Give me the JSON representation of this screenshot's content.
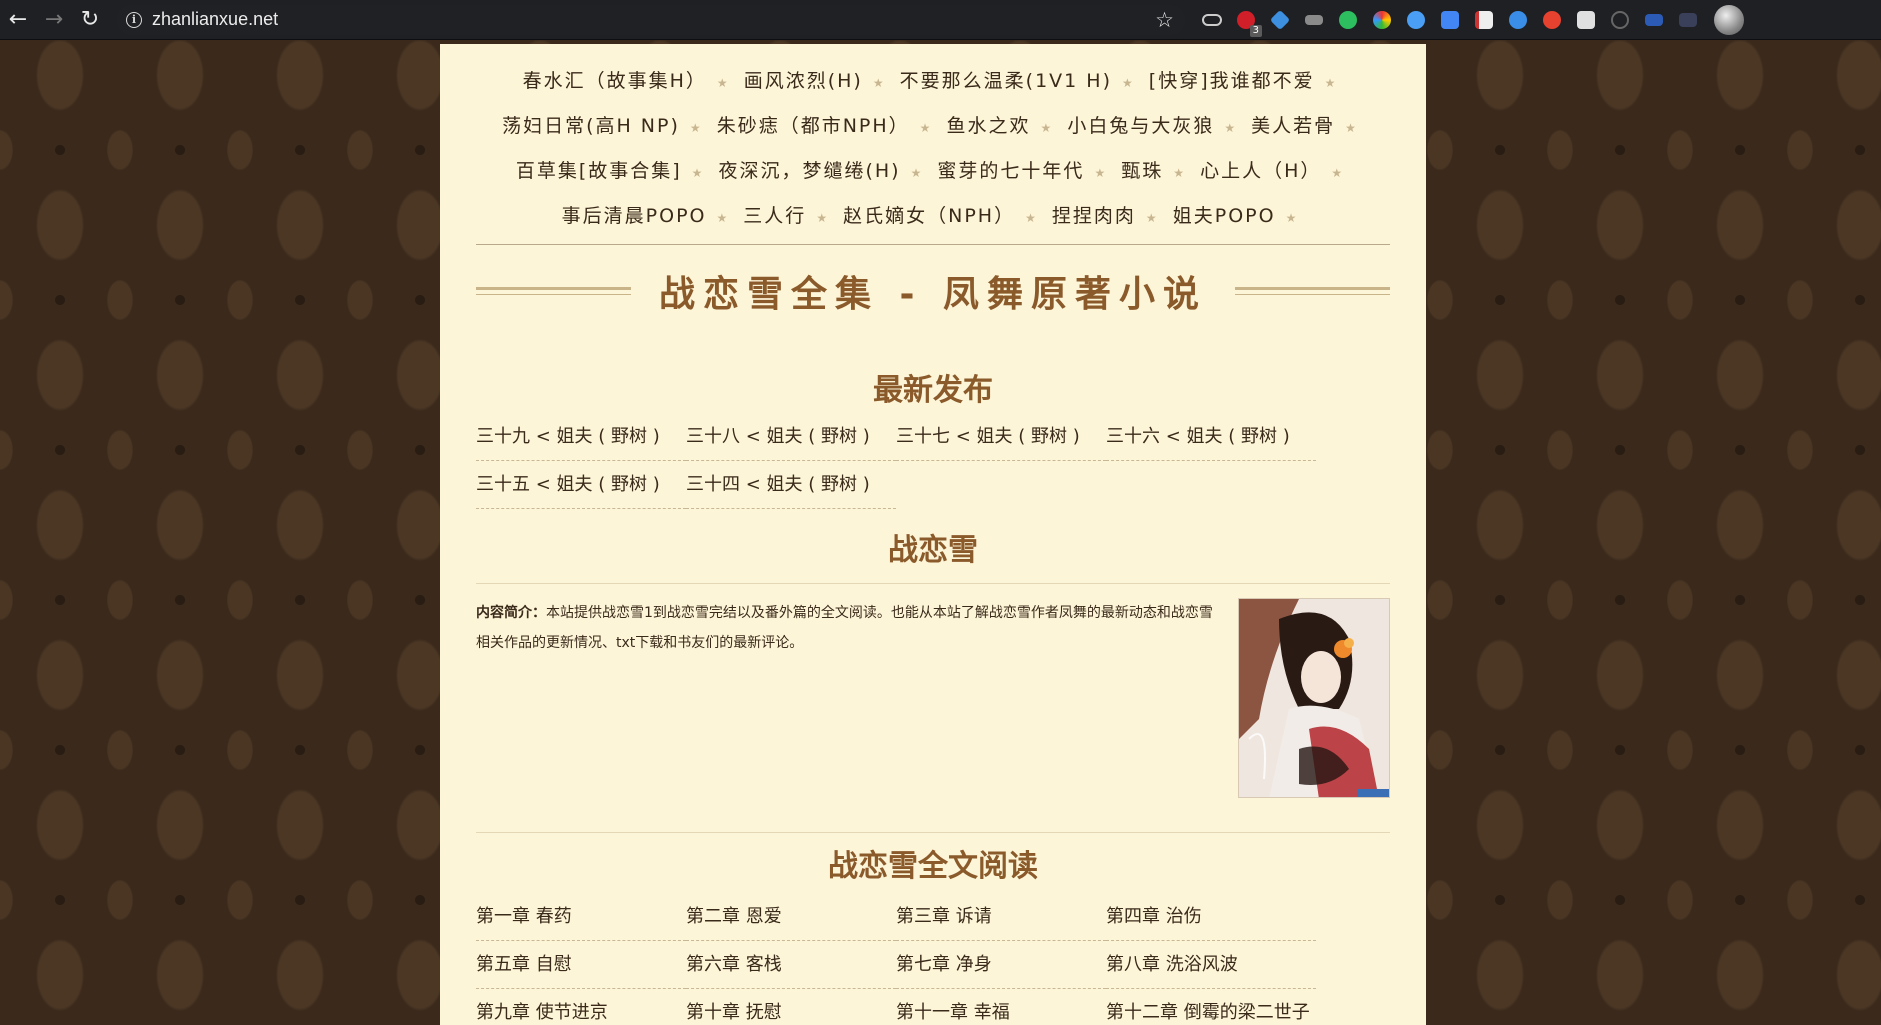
{
  "browser": {
    "url": "zhanlianxue.net",
    "extension_badge": "3"
  },
  "friend_links": [
    "春水汇（故事集H）",
    "画风浓烈(H)",
    "不要那么温柔(1V1 H)",
    "[快穿]我谁都不爱",
    "荡妇日常(高H NP)",
    "朱砂痣（都市NPH）",
    "鱼水之欢",
    "小白兔与大灰狼",
    "美人若骨",
    "百草集[故事合集]",
    "夜深沉，梦缱绻(H)",
    "蜜芽的七十年代",
    "甄珠",
    "心上人（H）",
    "事后清晨POPO",
    "三人行",
    "赵氏嫡女（NPH）",
    "捏捏肉肉",
    "姐夫POPO"
  ],
  "site_title": "战恋雪全集 - 凤舞原著小说",
  "latest": {
    "heading": "最新发布",
    "items": [
      "三十九 < 姐夫 ( 野树 )",
      "三十八 < 姐夫 ( 野树 )",
      "三十七 < 姐夫 ( 野树 )",
      "三十六 < 姐夫 ( 野树 )",
      "三十五 < 姐夫 ( 野树 )",
      "三十四 < 姐夫 ( 野树 )"
    ]
  },
  "book": {
    "title": "战恋雪",
    "intro_label": "内容简介：",
    "intro_text": "本站提供战恋雪1到战恋雪完结以及番外篇的全文阅读。也能从本站了解战恋雪作者凤舞的最新动态和战恋雪相关作品的更新情况、txt下载和书友们的最新评论。"
  },
  "chapters": {
    "heading": "战恋雪全文阅读",
    "items": [
      "第一章 春药",
      "第二章 恩爱",
      "第三章 诉请",
      "第四章 治伤",
      "第五章 自慰",
      "第六章 客栈",
      "第七章 净身",
      "第八章 洗浴风波",
      "第九章 使节进京",
      "第十章 抚慰",
      "第十一章 幸福",
      "第十二章 倒霉的梁二世子"
    ]
  }
}
